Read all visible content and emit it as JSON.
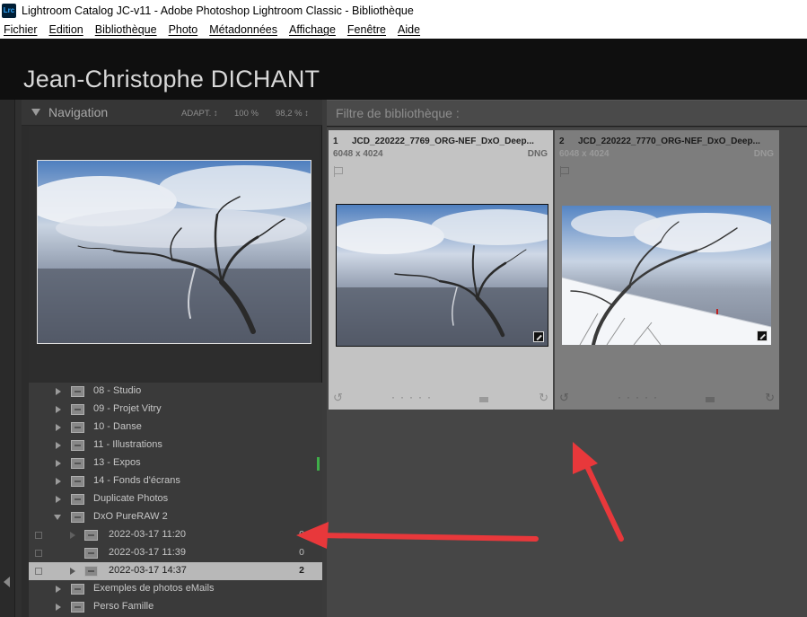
{
  "window": {
    "app_icon": "Lrc",
    "title": "Lightroom Catalog JC-v11 - Adobe Photoshop Lightroom Classic - Bibliothèque"
  },
  "menu": [
    "Fichier",
    "Edition",
    "Bibliothèque",
    "Photo",
    "Métadonnées",
    "Affichage",
    "Fenêtre",
    "Aide"
  ],
  "identity_plate": "Jean-Christophe DICHANT",
  "navigator": {
    "title": "Navigation",
    "zoom_fit": "ADAPT. ↕",
    "zoom_100": "100 %",
    "zoom_custom": "98,2 % ↕"
  },
  "folders": [
    {
      "label": "08 - Studio",
      "count": ""
    },
    {
      "label": "09 - Projet Vitry",
      "count": ""
    },
    {
      "label": "10 - Danse",
      "count": ""
    },
    {
      "label": "11 - Illustrations",
      "count": ""
    },
    {
      "label": "13 - Expos",
      "count": ""
    },
    {
      "label": "14 - Fonds d'écrans",
      "count": ""
    },
    {
      "label": "Duplicate Photos",
      "count": ""
    },
    {
      "label": "DxO PureRAW 2",
      "count": ""
    },
    {
      "label": "2022-03-17 11:20",
      "count": "0"
    },
    {
      "label": "2022-03-17 11:39",
      "count": "0"
    },
    {
      "label": "2022-03-17 14:37",
      "count": "2"
    },
    {
      "label": "Exemples de photos eMails",
      "count": ""
    },
    {
      "label": "Perso Famille",
      "count": ""
    }
  ],
  "filter_bar": {
    "title": "Filtre de bibliothèque :"
  },
  "grid": [
    {
      "index": "1",
      "filename": "JCD_220222_7769_ORG-NEF_DxO_Deep...",
      "dimensions": "6048 x 4024",
      "format": "DNG",
      "selected": true
    },
    {
      "index": "2",
      "filename": "JCD_220222_7770_ORG-NEF_DxO_Deep...",
      "dimensions": "6048 x 4024",
      "format": "DNG",
      "selected": false
    }
  ],
  "icons": {
    "rotate_left": "rotate-left-icon",
    "rotate_right": "rotate-right-icon",
    "flag": "flag-icon",
    "edited_badge": "develop-adjusted-badge-icon"
  },
  "colors": {
    "annotation_arrow": "#e8383b",
    "selected_cell": "#c3c3c3",
    "color_label_green": "#3fae49"
  }
}
